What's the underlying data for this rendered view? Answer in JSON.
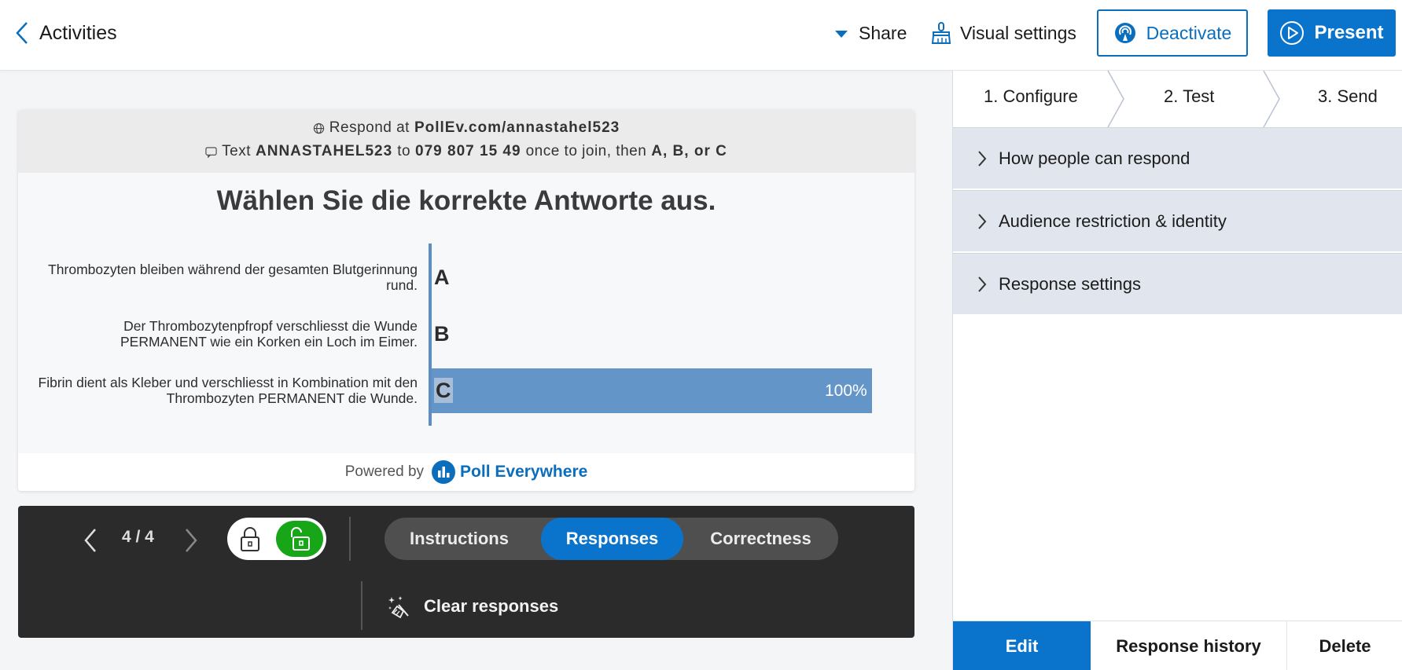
{
  "topbar": {
    "back_label": "Activities",
    "share_label": "Share",
    "visual_settings_label": "Visual settings",
    "deactivate_label": "Deactivate",
    "present_label": "Present",
    "accent_color": "#0a74cc"
  },
  "poll": {
    "respond_prefix": "Respond at",
    "respond_url": "PollEv.com/annastahel523",
    "text_prefix": "Text",
    "text_code": "ANNASTAHEL523",
    "text_to": "to",
    "phone": "079 807 15 49",
    "text_suffix": "once to join, then",
    "options_hint": "A, B, or C",
    "title": "Wählen Sie die korrekte Antworte aus.",
    "powered_by": "Powered by",
    "brand": "Poll Everywhere"
  },
  "chart_data": {
    "type": "bar",
    "orientation": "horizontal",
    "categories": [
      "Thrombozyten bleiben während der gesamten Blutgerinnung rund.",
      "Der Thrombozytenpfropf verschliesst die Wunde PERMANENT wie ein Korken ein Loch im Eimer.",
      "Fibrin dient als Kleber und verschliesst in Kombination mit den Thrombozyten PERMANENT die Wunde."
    ],
    "letters": [
      "A",
      "B",
      "C"
    ],
    "values": [
      0,
      0,
      100
    ],
    "value_labels": [
      "",
      "",
      "100%"
    ],
    "xlim": [
      0,
      100
    ],
    "bar_color": "#6495c8"
  },
  "controls": {
    "counter": "4 / 4",
    "segments": [
      "Instructions",
      "Responses",
      "Correctness"
    ],
    "active_segment": "Responses",
    "clear_label": "Clear responses"
  },
  "panel": {
    "steps": [
      "1. Configure",
      "2. Test",
      "3. Send"
    ],
    "sections": [
      "How people can respond",
      "Audience restriction & identity",
      "Response settings"
    ],
    "actions": {
      "edit": "Edit",
      "history": "Response history",
      "delete": "Delete"
    }
  }
}
